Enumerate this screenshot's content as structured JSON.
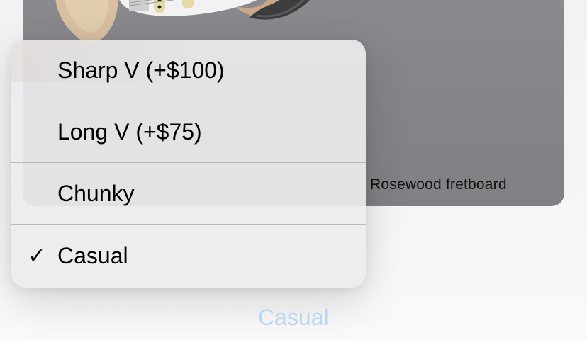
{
  "product_card": {
    "caption": "Rosewood fretboard"
  },
  "neck_shape_menu": {
    "items": [
      {
        "label": "Sharp V (+$100)",
        "checked": false
      },
      {
        "label": "Long V (+$75)",
        "checked": false
      },
      {
        "label": "Chunky",
        "checked": false
      },
      {
        "label": "Casual",
        "checked": true
      }
    ],
    "check_glyph": "✓"
  },
  "picker": {
    "selected_value": "Casual",
    "color": "#b8d6f2"
  }
}
